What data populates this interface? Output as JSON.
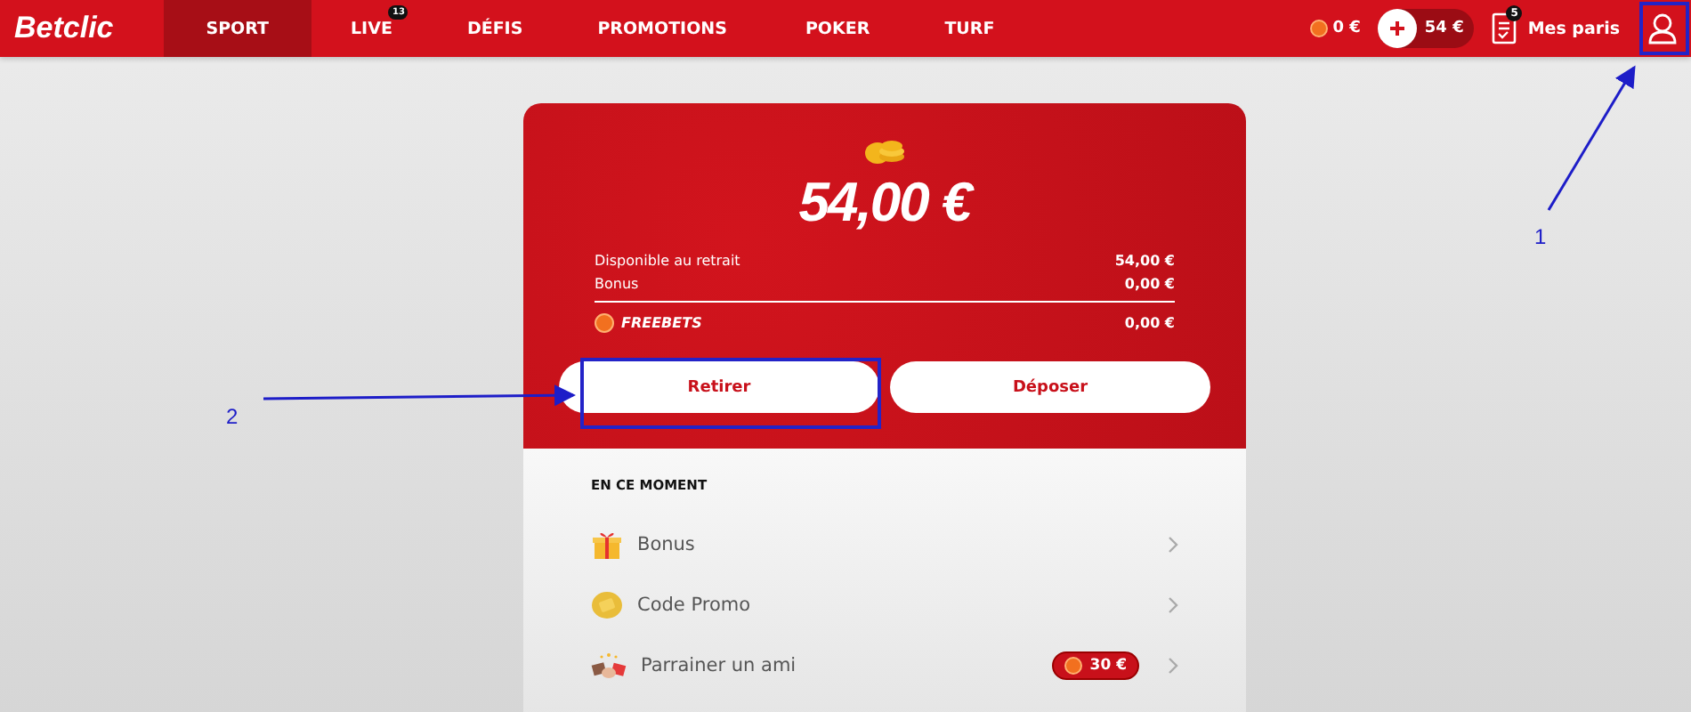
{
  "header": {
    "logo": "Betclic",
    "nav": [
      {
        "label": "SPORT",
        "selected": true
      },
      {
        "label": "LIVE",
        "selected": false,
        "badge": "13"
      },
      {
        "label": "DÉFIS",
        "selected": false
      },
      {
        "label": "PROMOTIONS",
        "selected": false
      },
      {
        "label": "POKER",
        "selected": false
      },
      {
        "label": "TURF",
        "selected": false
      }
    ],
    "freebet_balance": "0 €",
    "balance": "54 €",
    "bets": {
      "label": "Mes paris",
      "badge": "5"
    }
  },
  "wallet": {
    "total": "54,00 €",
    "rows": [
      {
        "kind": "plain",
        "label": "Disponible au retrait",
        "value": "54,00 €"
      },
      {
        "kind": "plain",
        "label": "Bonus",
        "value": "0,00 €"
      },
      {
        "kind": "freebet",
        "label": "FREEBETS",
        "value": "0,00 €"
      }
    ],
    "buttons": [
      "Retirer",
      "Déposer"
    ]
  },
  "now": {
    "title": "EN CE MOMENT",
    "items": [
      {
        "kind": "gift",
        "label": "Bonus"
      },
      {
        "kind": "ticket",
        "label": "Code Promo"
      },
      {
        "kind": "handshake",
        "label": "Parrainer un ami",
        "tag": "30 €"
      }
    ]
  },
  "annotations": [
    {
      "label": "1"
    },
    {
      "label": "2"
    }
  ]
}
